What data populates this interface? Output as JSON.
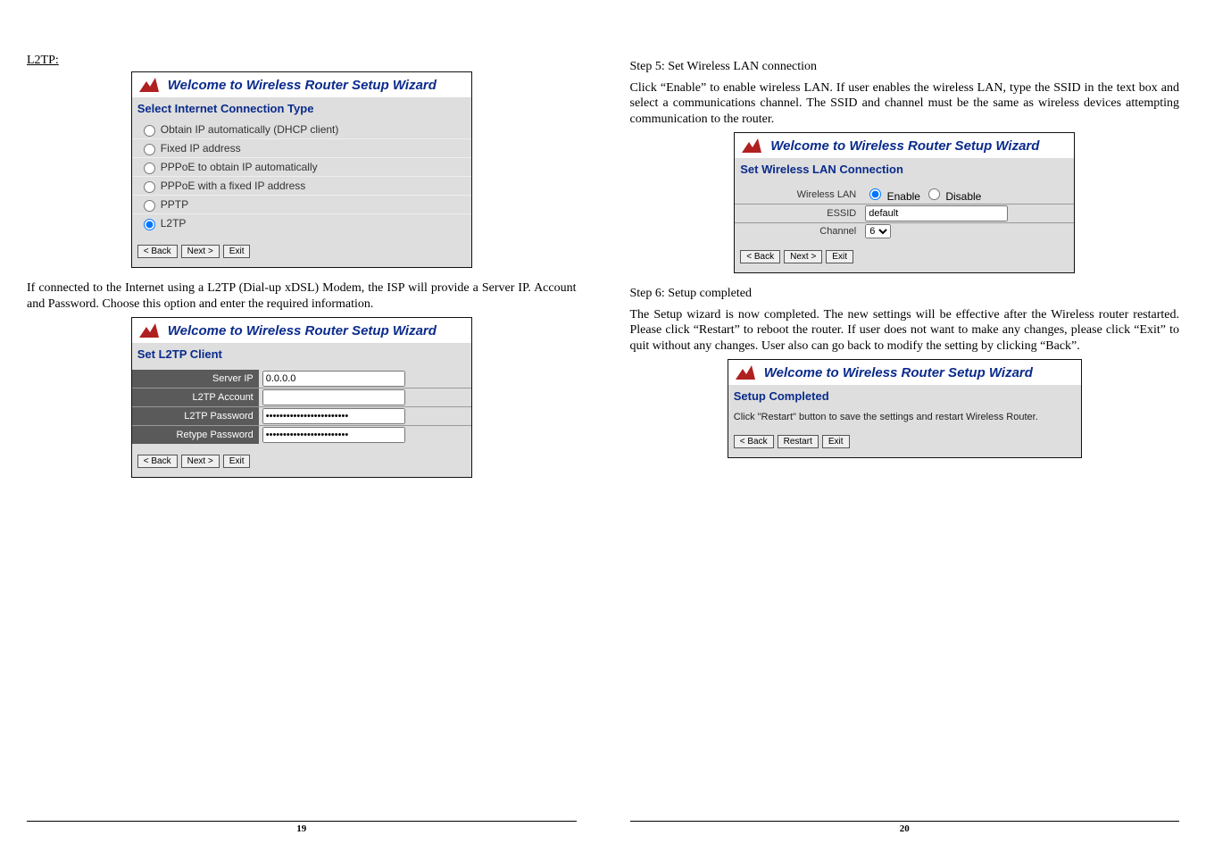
{
  "left": {
    "section_label": "L2TP:",
    "wizard_a": {
      "title": "Welcome to Wireless Router Setup Wizard",
      "subtitle": "Select Internet Connection Type",
      "options": [
        "Obtain IP automatically (DHCP client)",
        "Fixed IP address",
        "PPPoE to obtain IP automatically",
        "PPPoE with a fixed IP address",
        "PPTP",
        "L2TP"
      ],
      "buttons": {
        "back": "< Back",
        "next": "Next >",
        "exit": "Exit"
      }
    },
    "para1": "If connected to the Internet using a L2TP (Dial-up xDSL) Modem, the ISP will provide a Server IP. Account and Password. Choose this option and enter the required information.",
    "wizard_b": {
      "title": "Welcome to Wireless Router Setup Wizard",
      "subtitle": "Set L2TP Client",
      "rows": {
        "server_ip_label": "Server IP",
        "server_ip_value": "0.0.0.0",
        "account_label": "L2TP Account",
        "account_value": "",
        "password_label": "L2TP Password",
        "password_value": "••••••••••••••••••••••••",
        "retype_label": "Retype Password",
        "retype_value": "••••••••••••••••••••••••"
      },
      "buttons": {
        "back": "< Back",
        "next": "Next >",
        "exit": "Exit"
      }
    },
    "page_number": "19"
  },
  "right": {
    "step5_heading": "Step 5: Set Wireless LAN connection",
    "step5_para": "Click “Enable” to enable wireless LAN. If user enables the wireless LAN, type the SSID in the text box and select a communications channel. The SSID and channel must be the same as wireless devices attempting communication to the router.",
    "wizard_c": {
      "title": "Welcome to Wireless Router Setup Wizard",
      "subtitle": "Set Wireless LAN Connection",
      "rows": {
        "wlan_label": "Wireless LAN",
        "enable_label": "Enable",
        "disable_label": "Disable",
        "essid_label": "ESSID",
        "essid_value": "default",
        "channel_label": "Channel",
        "channel_value": "6"
      },
      "buttons": {
        "back": "< Back",
        "next": "Next >",
        "exit": "Exit"
      }
    },
    "step6_heading": "Step 6: Setup completed",
    "step6_para": "The Setup wizard is now completed. The new settings will be effective after the Wireless router restarted. Please click “Restart” to reboot the router. If user does not want to make any changes, please click “Exit” to quit without any changes. User also can go back to modify the setting by clicking “Back”.",
    "wizard_d": {
      "title": "Welcome to Wireless Router Setup Wizard",
      "subtitle": "Setup Completed",
      "message": "Click \"Restart\" button to save the settings and restart Wireless Router.",
      "buttons": {
        "back": "< Back",
        "restart": "Restart",
        "exit": "Exit"
      }
    },
    "page_number": "20"
  }
}
